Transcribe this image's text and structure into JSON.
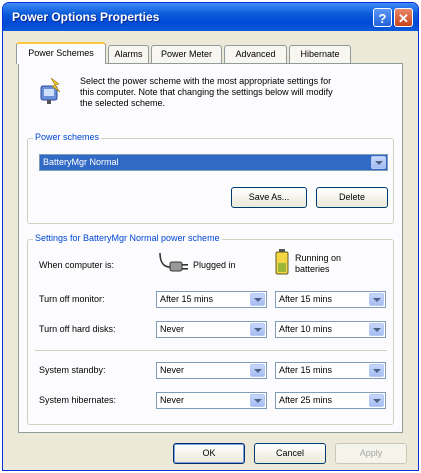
{
  "window": {
    "title": "Power Options Properties"
  },
  "tabs": [
    {
      "label": "Power Schemes",
      "active": true
    },
    {
      "label": "Alarms",
      "active": false
    },
    {
      "label": "Power Meter",
      "active": false
    },
    {
      "label": "Advanced",
      "active": false
    },
    {
      "label": "Hibernate",
      "active": false
    }
  ],
  "intro": {
    "text_lines": [
      "Select the power scheme with the most appropriate settings for",
      "this computer. Note that changing the settings below will modify",
      "the selected scheme."
    ],
    "icon": "power-scheme-icon"
  },
  "schemes": {
    "legend": "Power schemes",
    "selected": "BatteryMgr Normal",
    "save_as_label": "Save As...",
    "delete_label": "Delete"
  },
  "settings": {
    "legend": "Settings for BatteryMgr Normal power scheme",
    "when_label": "When computer is:",
    "plugged_label": "Plugged in",
    "battery_label_line1": "Running on",
    "battery_label_line2": "batteries",
    "rows": [
      {
        "label": "Turn off monitor:",
        "plugged": "After 15 mins",
        "battery": "After 15 mins"
      },
      {
        "label": "Turn off hard disks:",
        "plugged": "Never",
        "battery": "After 10 mins"
      },
      {
        "label": "System standby:",
        "plugged": "Never",
        "battery": "After 15 mins"
      },
      {
        "label": "System hibernates:",
        "plugged": "Never",
        "battery": "After 25 mins"
      }
    ]
  },
  "footer": {
    "ok_label": "OK",
    "cancel_label": "Cancel",
    "apply_label": "Apply"
  },
  "colors": {
    "title_bar": "#0a5ad9",
    "selection": "#316ac5",
    "tab_highlight": "#ffc83c"
  }
}
